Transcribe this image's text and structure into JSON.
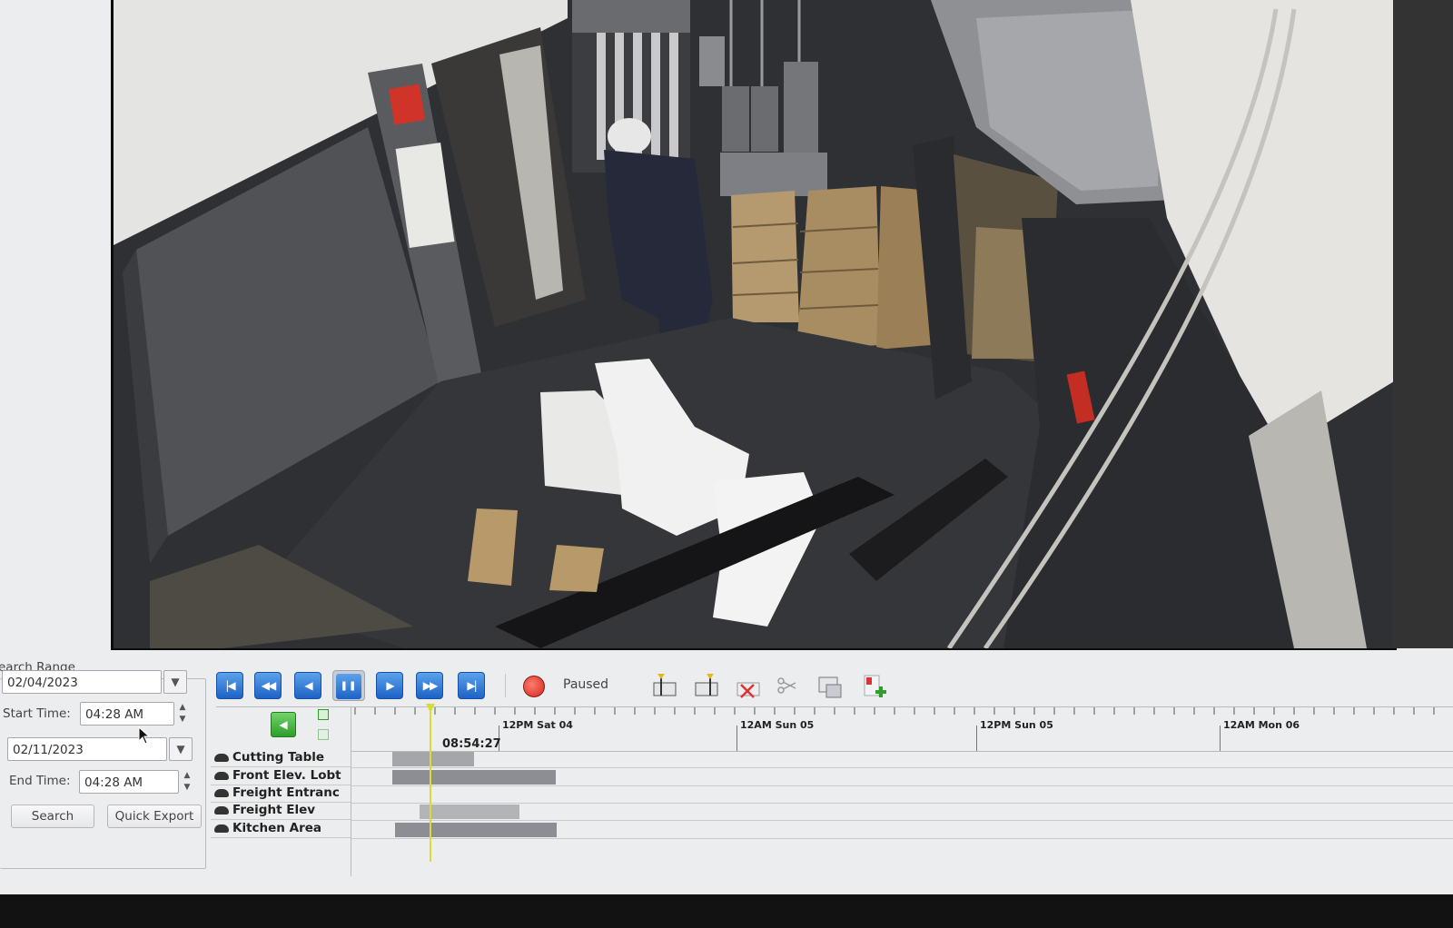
{
  "search_panel": {
    "title": "earch Range",
    "start_date": "02/04/2023",
    "start_time_label": "Start Time:",
    "start_time": "04:28 AM",
    "end_date": "02/11/2023",
    "end_time_label": "End Time:",
    "end_time": "04:28 AM",
    "search_label": "Search",
    "quick_export_label": "Quick Export"
  },
  "playback": {
    "status": "Paused"
  },
  "timeline": {
    "cursor_time": "08:54:27",
    "tick_labels": [
      "12PM Sat 04",
      "12AM Sun 05",
      "12PM Sun 05",
      "12AM Mon 06"
    ],
    "cameras": [
      "Cutting Table",
      "Front Elev. Lobt",
      "Freight Entranc",
      "Freight Elev",
      "Kitchen Area"
    ]
  },
  "colors": {
    "accent_blue": "#2f7ad8",
    "record_red": "#d12a1f",
    "marker_yellow": "#d8dd35",
    "nav_green": "#2e9d2a"
  }
}
